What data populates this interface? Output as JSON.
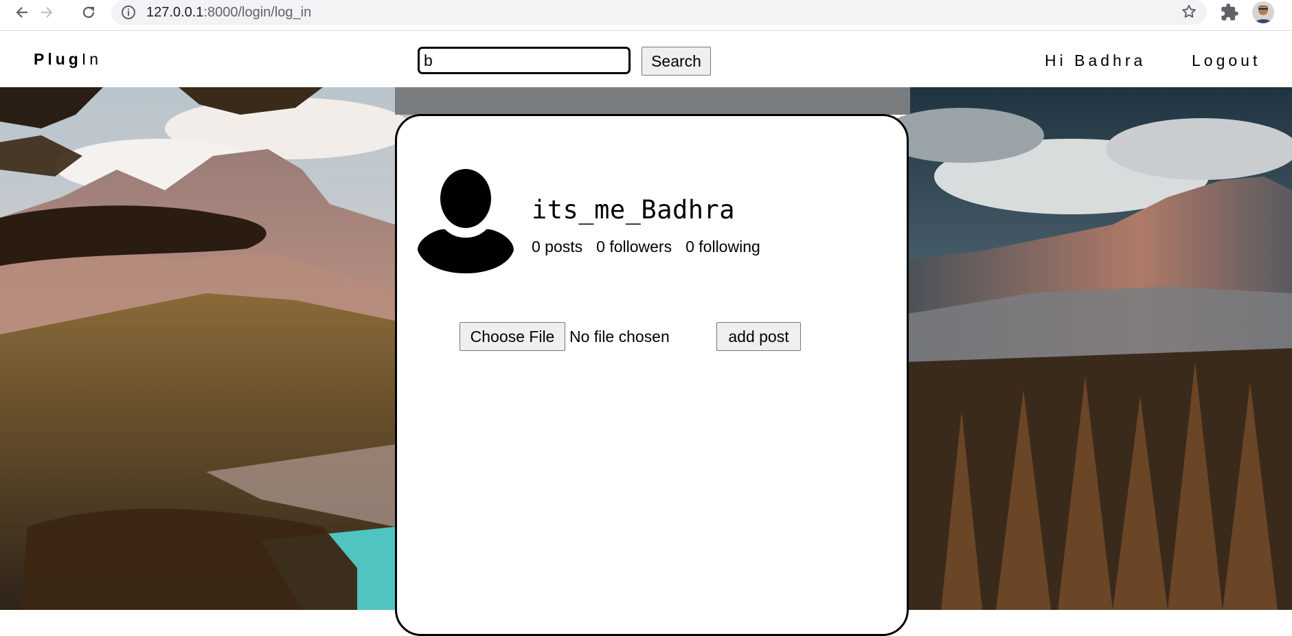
{
  "browser": {
    "url_host": "127.0.0.1",
    "url_path": ":8000/login/log_in",
    "icons": [
      "back-arrow-icon",
      "forward-arrow-icon",
      "reload-icon",
      "info-icon",
      "star-icon",
      "puzzle-icon",
      "profile-avatar"
    ]
  },
  "header": {
    "brand_bold": "Plug",
    "brand_light": "In",
    "search": {
      "value": "b",
      "button_label": "Search"
    },
    "greeting": "Hi Badhra",
    "logout_label": "Logout"
  },
  "profile": {
    "username": "its_me_Badhra",
    "posts": "0 posts",
    "followers": "0 followers",
    "following": "0 following",
    "avatar_icon": "user-silhouette-icon"
  },
  "upload": {
    "choose_label": "Choose File",
    "file_status": "No file chosen",
    "submit_label": "add post"
  },
  "colors": {
    "card_border": "#000000",
    "button_bg": "#efefef",
    "omnibox_bg": "#f1f3f4"
  }
}
